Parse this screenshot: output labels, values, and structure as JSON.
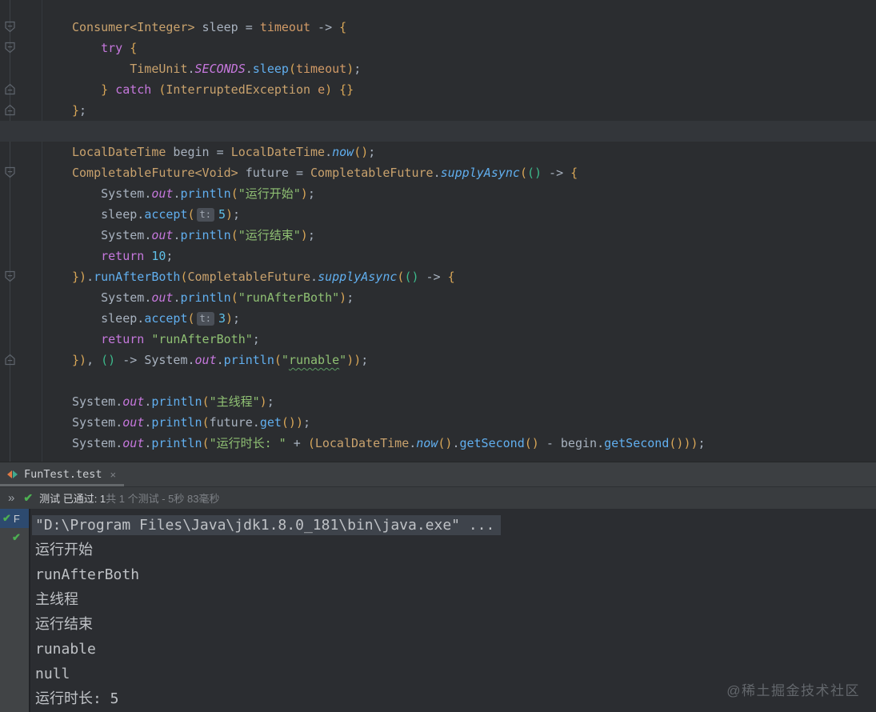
{
  "editor": {
    "lines": [
      {
        "fold": "down",
        "indent": 0,
        "segs": [
          {
            "t": "Consumer<Integer>",
            "c": "t"
          },
          {
            "t": " sleep = ",
            "c": "d"
          },
          {
            "t": "timeout",
            "c": "p"
          },
          {
            "t": " -> ",
            "c": "d"
          },
          {
            "t": "{",
            "c": "y"
          }
        ]
      },
      {
        "fold": "down",
        "indent": 1,
        "segs": [
          {
            "t": "try",
            "c": "k"
          },
          {
            "t": " ",
            "c": "d"
          },
          {
            "t": "{",
            "c": "y"
          }
        ]
      },
      {
        "indent": 2,
        "segs": [
          {
            "t": "TimeUnit",
            "c": "t"
          },
          {
            "t": ".",
            "c": "d"
          },
          {
            "t": "SECONDS",
            "c": "f"
          },
          {
            "t": ".",
            "c": "d"
          },
          {
            "t": "sleep",
            "c": "m"
          },
          {
            "t": "(",
            "c": "y"
          },
          {
            "t": "timeout",
            "c": "p"
          },
          {
            "t": ")",
            "c": "y"
          },
          {
            "t": ";",
            "c": "d"
          }
        ]
      },
      {
        "fold": "up",
        "indent": 1,
        "segs": [
          {
            "t": "}",
            "c": "y"
          },
          {
            "t": " ",
            "c": "d"
          },
          {
            "t": "catch",
            "c": "k"
          },
          {
            "t": " ",
            "c": "d"
          },
          {
            "t": "(",
            "c": "y"
          },
          {
            "t": "InterruptedException",
            "c": "t"
          },
          {
            "t": " ",
            "c": "d"
          },
          {
            "t": "e",
            "c": "p"
          },
          {
            "t": ")",
            "c": "y"
          },
          {
            "t": " ",
            "c": "d"
          },
          {
            "t": "{}",
            "c": "y"
          }
        ]
      },
      {
        "fold": "up",
        "indent": 0,
        "segs": [
          {
            "t": "}",
            "c": "y"
          },
          {
            "t": ";",
            "c": "d"
          }
        ]
      },
      {
        "indent": 0,
        "current": true,
        "segs": []
      },
      {
        "indent": 0,
        "segs": [
          {
            "t": "LocalDateTime",
            "c": "t"
          },
          {
            "t": " begin = ",
            "c": "d"
          },
          {
            "t": "LocalDateTime",
            "c": "t"
          },
          {
            "t": ".",
            "c": "d"
          },
          {
            "t": "now",
            "c": "sm"
          },
          {
            "t": "()",
            "c": "y"
          },
          {
            "t": ";",
            "c": "d"
          }
        ]
      },
      {
        "fold": "down",
        "indent": 0,
        "segs": [
          {
            "t": "CompletableFuture<Void>",
            "c": "t"
          },
          {
            "t": " future = ",
            "c": "d"
          },
          {
            "t": "CompletableFuture",
            "c": "t"
          },
          {
            "t": ".",
            "c": "d"
          },
          {
            "t": "supplyAsync",
            "c": "sm"
          },
          {
            "t": "(",
            "c": "y"
          },
          {
            "t": "()",
            "c": "tl"
          },
          {
            "t": " -> ",
            "c": "d"
          },
          {
            "t": "{",
            "c": "y"
          }
        ]
      },
      {
        "indent": 1,
        "segs": [
          {
            "t": "System",
            "c": "d"
          },
          {
            "t": ".",
            "c": "d"
          },
          {
            "t": "out",
            "c": "f"
          },
          {
            "t": ".",
            "c": "d"
          },
          {
            "t": "println",
            "c": "m"
          },
          {
            "t": "(",
            "c": "y"
          },
          {
            "t": "\"运行开始\"",
            "c": "s"
          },
          {
            "t": ")",
            "c": "y"
          },
          {
            "t": ";",
            "c": "d"
          }
        ]
      },
      {
        "indent": 1,
        "segs": [
          {
            "t": "sleep",
            "c": "d"
          },
          {
            "t": ".",
            "c": "d"
          },
          {
            "t": "accept",
            "c": "m"
          },
          {
            "t": "(",
            "c": "y"
          },
          {
            "t": "t:",
            "c": "hint"
          },
          {
            "t": "5",
            "c": "n"
          },
          {
            "t": ")",
            "c": "y"
          },
          {
            "t": ";",
            "c": "d"
          }
        ]
      },
      {
        "indent": 1,
        "segs": [
          {
            "t": "System",
            "c": "d"
          },
          {
            "t": ".",
            "c": "d"
          },
          {
            "t": "out",
            "c": "f"
          },
          {
            "t": ".",
            "c": "d"
          },
          {
            "t": "println",
            "c": "m"
          },
          {
            "t": "(",
            "c": "y"
          },
          {
            "t": "\"运行结束\"",
            "c": "s"
          },
          {
            "t": ")",
            "c": "y"
          },
          {
            "t": ";",
            "c": "d"
          }
        ]
      },
      {
        "indent": 1,
        "segs": [
          {
            "t": "return",
            "c": "k"
          },
          {
            "t": " ",
            "c": "d"
          },
          {
            "t": "10",
            "c": "n"
          },
          {
            "t": ";",
            "c": "d"
          }
        ]
      },
      {
        "fold": "down",
        "indent": 0,
        "segs": [
          {
            "t": "})",
            "c": "y"
          },
          {
            "t": ".",
            "c": "d"
          },
          {
            "t": "runAfterBoth",
            "c": "m"
          },
          {
            "t": "(",
            "c": "y"
          },
          {
            "t": "CompletableFuture",
            "c": "t"
          },
          {
            "t": ".",
            "c": "d"
          },
          {
            "t": "supplyAsync",
            "c": "sm"
          },
          {
            "t": "(",
            "c": "y"
          },
          {
            "t": "()",
            "c": "tl"
          },
          {
            "t": " -> ",
            "c": "d"
          },
          {
            "t": "{",
            "c": "y"
          }
        ]
      },
      {
        "indent": 1,
        "segs": [
          {
            "t": "System",
            "c": "d"
          },
          {
            "t": ".",
            "c": "d"
          },
          {
            "t": "out",
            "c": "f"
          },
          {
            "t": ".",
            "c": "d"
          },
          {
            "t": "println",
            "c": "m"
          },
          {
            "t": "(",
            "c": "y"
          },
          {
            "t": "\"runAfterBoth\"",
            "c": "s"
          },
          {
            "t": ")",
            "c": "y"
          },
          {
            "t": ";",
            "c": "d"
          }
        ]
      },
      {
        "indent": 1,
        "segs": [
          {
            "t": "sleep",
            "c": "d"
          },
          {
            "t": ".",
            "c": "d"
          },
          {
            "t": "accept",
            "c": "m"
          },
          {
            "t": "(",
            "c": "y"
          },
          {
            "t": "t:",
            "c": "hint"
          },
          {
            "t": "3",
            "c": "n"
          },
          {
            "t": ")",
            "c": "y"
          },
          {
            "t": ";",
            "c": "d"
          }
        ]
      },
      {
        "indent": 1,
        "segs": [
          {
            "t": "return",
            "c": "k"
          },
          {
            "t": " ",
            "c": "d"
          },
          {
            "t": "\"runAfterBoth\"",
            "c": "s"
          },
          {
            "t": ";",
            "c": "d"
          }
        ]
      },
      {
        "fold": "up",
        "indent": 0,
        "segs": [
          {
            "t": "})",
            "c": "y"
          },
          {
            "t": ", ",
            "c": "d"
          },
          {
            "t": "()",
            "c": "tl"
          },
          {
            "t": " -> ",
            "c": "d"
          },
          {
            "t": "System",
            "c": "d"
          },
          {
            "t": ".",
            "c": "d"
          },
          {
            "t": "out",
            "c": "f"
          },
          {
            "t": ".",
            "c": "d"
          },
          {
            "t": "println",
            "c": "m"
          },
          {
            "t": "(",
            "c": "y"
          },
          {
            "t": "\"",
            "c": "s"
          },
          {
            "t": "runable",
            "c": "sw"
          },
          {
            "t": "\"",
            "c": "s"
          },
          {
            "t": "))",
            "c": "y"
          },
          {
            "t": ";",
            "c": "d"
          }
        ]
      },
      {
        "indent": 0,
        "segs": []
      },
      {
        "indent": 0,
        "segs": [
          {
            "t": "System",
            "c": "d"
          },
          {
            "t": ".",
            "c": "d"
          },
          {
            "t": "out",
            "c": "f"
          },
          {
            "t": ".",
            "c": "d"
          },
          {
            "t": "println",
            "c": "m"
          },
          {
            "t": "(",
            "c": "y"
          },
          {
            "t": "\"主线程\"",
            "c": "s"
          },
          {
            "t": ")",
            "c": "y"
          },
          {
            "t": ";",
            "c": "d"
          }
        ]
      },
      {
        "indent": 0,
        "segs": [
          {
            "t": "System",
            "c": "d"
          },
          {
            "t": ".",
            "c": "d"
          },
          {
            "t": "out",
            "c": "f"
          },
          {
            "t": ".",
            "c": "d"
          },
          {
            "t": "println",
            "c": "m"
          },
          {
            "t": "(",
            "c": "y"
          },
          {
            "t": "future",
            "c": "d"
          },
          {
            "t": ".",
            "c": "d"
          },
          {
            "t": "get",
            "c": "m"
          },
          {
            "t": "()",
            "c": "y"
          },
          {
            "t": ")",
            "c": "y"
          },
          {
            "t": ";",
            "c": "d"
          }
        ]
      },
      {
        "indent": 0,
        "segs": [
          {
            "t": "System",
            "c": "d"
          },
          {
            "t": ".",
            "c": "d"
          },
          {
            "t": "out",
            "c": "f"
          },
          {
            "t": ".",
            "c": "d"
          },
          {
            "t": "println",
            "c": "m"
          },
          {
            "t": "(",
            "c": "y"
          },
          {
            "t": "\"运行时长: \"",
            "c": "s"
          },
          {
            "t": " + ",
            "c": "d"
          },
          {
            "t": "(",
            "c": "y"
          },
          {
            "t": "LocalDateTime",
            "c": "t"
          },
          {
            "t": ".",
            "c": "d"
          },
          {
            "t": "now",
            "c": "sm"
          },
          {
            "t": "()",
            "c": "y"
          },
          {
            "t": ".",
            "c": "d"
          },
          {
            "t": "getSecond",
            "c": "m"
          },
          {
            "t": "()",
            "c": "y"
          },
          {
            "t": " - ",
            "c": "d"
          },
          {
            "t": "begin",
            "c": "d"
          },
          {
            "t": ".",
            "c": "d"
          },
          {
            "t": "getSecond",
            "c": "m"
          },
          {
            "t": "()",
            "c": "y"
          },
          {
            "t": "))",
            "c": "y"
          },
          {
            "t": ";",
            "c": "d"
          }
        ]
      }
    ]
  },
  "run_panel": {
    "tab": {
      "label": "FunTest.test",
      "close": "×"
    },
    "status": {
      "expand_icon": "»",
      "text_bright": "测试 已通过: 1",
      "text_dim": "共 1 个测试 - 5秒 83毫秒"
    }
  },
  "console": {
    "tree": [
      {
        "label": "F",
        "selected": true
      },
      {
        "label": "",
        "selected": false
      }
    ],
    "lines": [
      {
        "text": "\"D:\\Program Files\\Java\\jdk1.8.0_181\\bin\\java.exe\" ...",
        "selected": true
      },
      {
        "text": "运行开始"
      },
      {
        "text": "runAfterBoth"
      },
      {
        "text": "主线程"
      },
      {
        "text": "运行结束"
      },
      {
        "text": "runable"
      },
      {
        "text": "null"
      },
      {
        "text": "运行时长: 5"
      }
    ]
  },
  "watermark": "@稀土掘金技术社区",
  "colors": {
    "editor_bg": "#2B2D30",
    "panel_bg": "#3C3F42",
    "keyword": "#C678DD",
    "type": "#C9A26D",
    "method": "#61AFEF",
    "string": "#8FC073",
    "number": "#5FC0E8",
    "parameter": "#D19A66",
    "brace": "#D8A657",
    "lambda_paren": "#3DBA8C",
    "test_passed_green": "#4DB052",
    "tree_selection": "#2D4A6F"
  }
}
